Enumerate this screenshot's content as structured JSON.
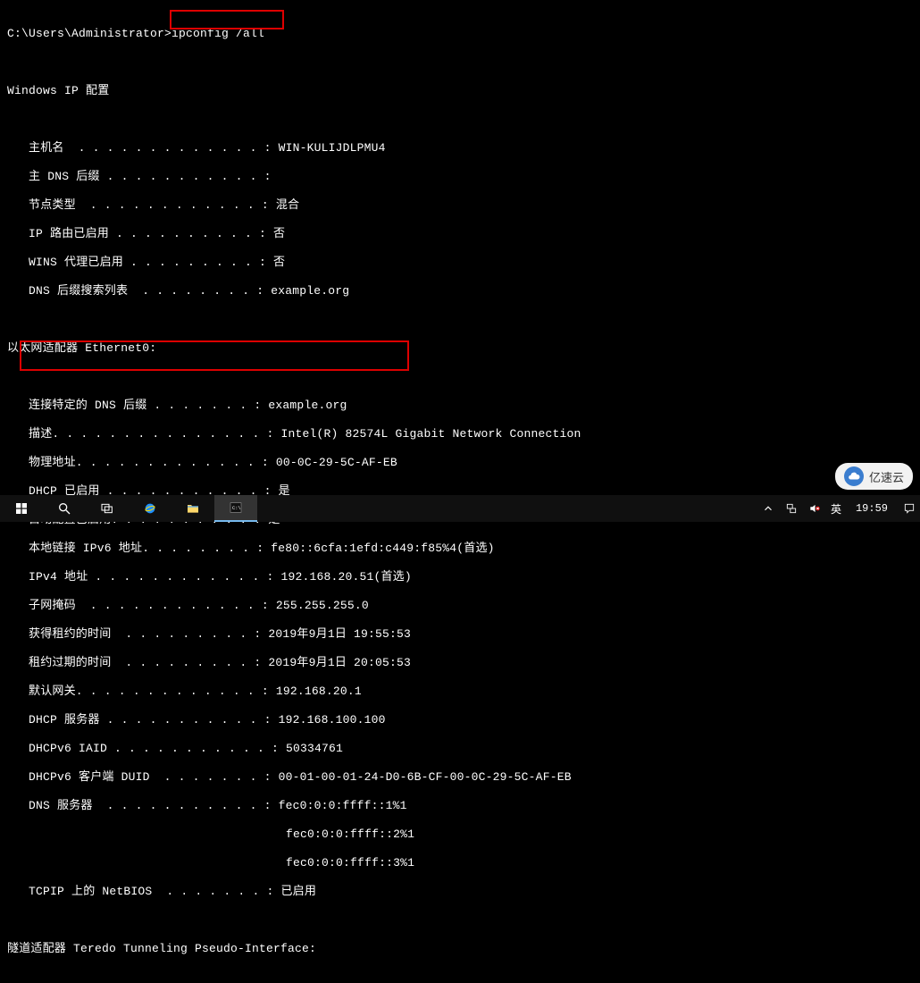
{
  "terminal": {
    "prompt": "C:\\Users\\Administrator>",
    "command": "ipconfig /all",
    "blank": "",
    "title1": "Windows IP 配置",
    "host": {
      "hostname": "   主机名  . . . . . . . . . . . . . : WIN-KULIJDLPMU4",
      "primdns": "   主 DNS 后缀 . . . . . . . . . . . :",
      "nodetype": "   节点类型  . . . . . . . . . . . . : 混合",
      "iproute": "   IP 路由已启用 . . . . . . . . . . : 否",
      "winsproxy": "   WINS 代理已启用 . . . . . . . . . : 否",
      "dnssearch": "   DNS 后缀搜索列表  . . . . . . . . : example.org"
    },
    "adapter_title": "以太网适配器 Ethernet0:",
    "eth": {
      "conndns": "   连接特定的 DNS 后缀 . . . . . . . : example.org",
      "descr": "   描述. . . . . . . . . . . . . . . : Intel(R) 82574L Gigabit Network Connection",
      "phys": "   物理地址. . . . . . . . . . . . . : 00-0C-29-5C-AF-EB",
      "dhcpen": "   DHCP 已启用 . . . . . . . . . . . : 是",
      "autocfg": "   自动配置已启用. . . . . . . . . . : 是",
      "linkv6": "   本地链接 IPv6 地址. . . . . . . . : fe80::6cfa:1efd:c449:f85%4(首选)",
      "ipv4": "   IPv4 地址 . . . . . . . . . . . . : 192.168.20.51(首选)",
      "subnet": "   子网掩码  . . . . . . . . . . . . : 255.255.255.0",
      "leaseob": "   获得租约的时间  . . . . . . . . . : 2019年9月1日 19:55:53",
      "leaseex": "   租约过期的时间  . . . . . . . . . : 2019年9月1日 20:05:53",
      "gateway": "   默认网关. . . . . . . . . . . . . : 192.168.20.1",
      "dhcpsrv": "   DHCP 服务器 . . . . . . . . . . . : 192.168.100.100",
      "dhcpv6ia": "   DHCPv6 IAID . . . . . . . . . . . : 50334761",
      "dhcpv6du": "   DHCPv6 客户端 DUID  . . . . . . . : 00-01-00-01-24-D0-6B-CF-00-0C-29-5C-AF-EB",
      "dns1": "   DNS 服务器  . . . . . . . . . . . : fec0:0:0:ffff::1%1",
      "dns2": "                                       fec0:0:0:ffff::2%1",
      "dns3": "                                       fec0:0:0:ffff::3%1",
      "netbios": "   TCPIP 上的 NetBIOS  . . . . . . . : 已启用"
    },
    "tunnel_title": "隧道适配器 Teredo Tunneling Pseudo-Interface:"
  },
  "taskbar": {
    "lang1": "英",
    "clock": "19:59"
  },
  "watermark": {
    "icon_label": "云",
    "text": "亿速云"
  }
}
